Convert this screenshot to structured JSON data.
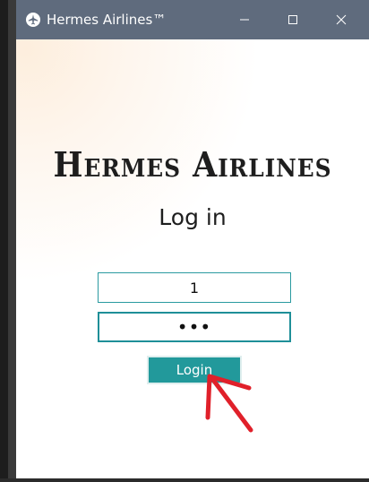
{
  "window": {
    "title": "Hermes Airlines™",
    "app_icon": "plane-icon"
  },
  "titlebar_controls": {
    "minimize_icon": "minimize-icon",
    "maximize_icon": "maximize-icon",
    "close_icon": "close-icon"
  },
  "form": {
    "brand": "Hermes Airlines",
    "heading": "Log in",
    "username_value": "1",
    "password_value": "•••",
    "login_label": "Login"
  },
  "annotation": {
    "icon": "arrow-pointer-icon",
    "color": "#e0202a"
  },
  "colors": {
    "titlebar": "#5f6b7d",
    "accent": "#22999b",
    "field_border": "#2a9aa0"
  }
}
